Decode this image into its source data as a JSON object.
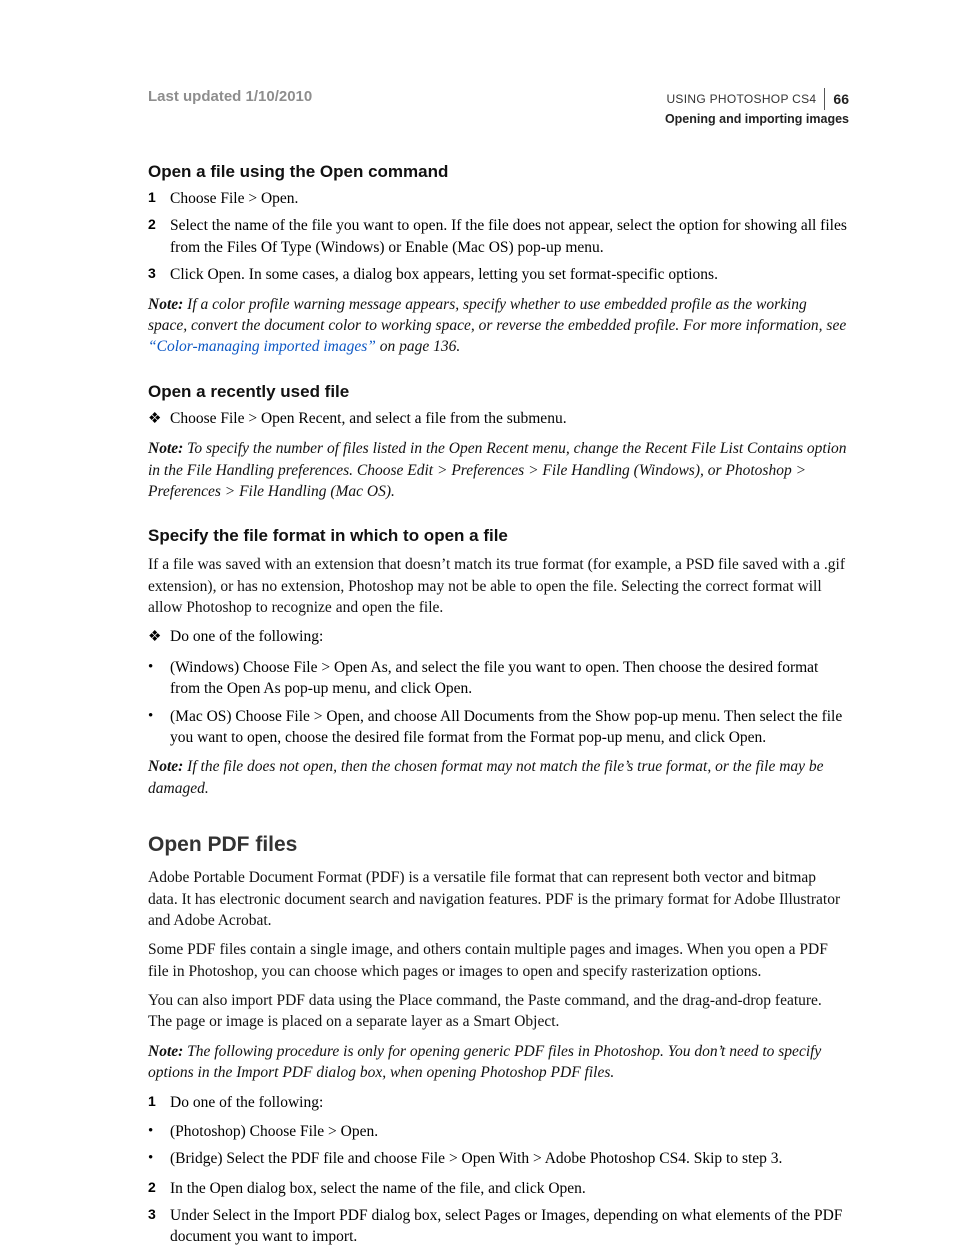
{
  "header": {
    "last_updated": "Last updated 1/10/2010",
    "using": "USING PHOTOSHOP CS4",
    "page_number": "66",
    "section": "Opening and importing images"
  },
  "s1": {
    "title": "Open a file using the Open command",
    "step1": "Choose File > Open.",
    "step2": "Select the name of the file you want to open. If the file does not appear, select the option for showing all files from the Files Of Type (Windows) or Enable (Mac OS) pop-up menu.",
    "step3": "Click Open. In some cases, a dialog box appears, letting you set format-specific options.",
    "note_label": "Note: ",
    "note_a": "If a color profile warning message appears, specify whether to use embedded profile as the working space, convert the document color to working space, or reverse the embedded profile. For more information, see ",
    "note_link": "“Color-managing imported images”",
    "note_b": " on page 136."
  },
  "s2": {
    "title": "Open a recently used file",
    "bullet": "Choose File > Open Recent, and select a file from the submenu.",
    "note_label": "Note: ",
    "note": "To specify the number of files listed in the Open Recent menu, change the Recent File List Contains option in the File Handling preferences. Choose Edit > Preferences > File Handling (Windows), or Photoshop > Preferences > File Handling (Mac OS)."
  },
  "s3": {
    "title": "Specify the file format in which to open a file",
    "intro": "If a file was saved with an extension that doesn’t match its true format (for example, a PSD file saved with a .gif extension), or has no extension, Photoshop may not be able to open the file. Selecting the correct format will allow Photoshop to recognize and open the file.",
    "lead": "Do one of the following:",
    "b1": "(Windows) Choose File > Open As, and select the file you want to open. Then choose the desired format from the Open As pop-up menu, and click Open.",
    "b2": "(Mac OS) Choose File > Open, and choose All Documents from the Show pop-up menu. Then select the file you want to open, choose the desired file format from the Format pop-up menu, and click Open.",
    "note_label": "Note: ",
    "note": "If the file does not open, then the chosen format may not match the file’s true format, or the file may be damaged."
  },
  "s4": {
    "title": "Open PDF files",
    "p1": "Adobe Portable Document Format (PDF) is a versatile file format that can represent both vector and bitmap data. It has electronic document search and navigation features. PDF is the primary format for Adobe Illustrator and Adobe Acrobat.",
    "p2": "Some PDF files contain a single image, and others contain multiple pages and images. When you open a PDF file in Photoshop, you can choose which pages or images to open and specify rasterization options.",
    "p3": "You can also import PDF data using the Place command, the Paste command, and the drag-and-drop feature. The page or image is placed on a separate layer as a Smart Object.",
    "note_label": "Note: ",
    "note": "The following procedure is only for opening generic PDF files in Photoshop. You don’t need to specify options in the Import PDF dialog box, when opening Photoshop PDF files.",
    "step1": "Do one of the following:",
    "b1": "(Photoshop) Choose File > Open.",
    "b2": "(Bridge) Select the PDF file and choose File > Open With > Adobe Photoshop CS4. Skip to step 3.",
    "step2": "In the Open dialog box, select the name of the file, and click Open.",
    "step3": "Under Select in the Import PDF dialog box, select Pages or Images, depending on what elements of the PDF document you want to import."
  },
  "markers": {
    "n1": "1",
    "n2": "2",
    "n3": "3",
    "dot": "•",
    "diamond": "❖"
  }
}
